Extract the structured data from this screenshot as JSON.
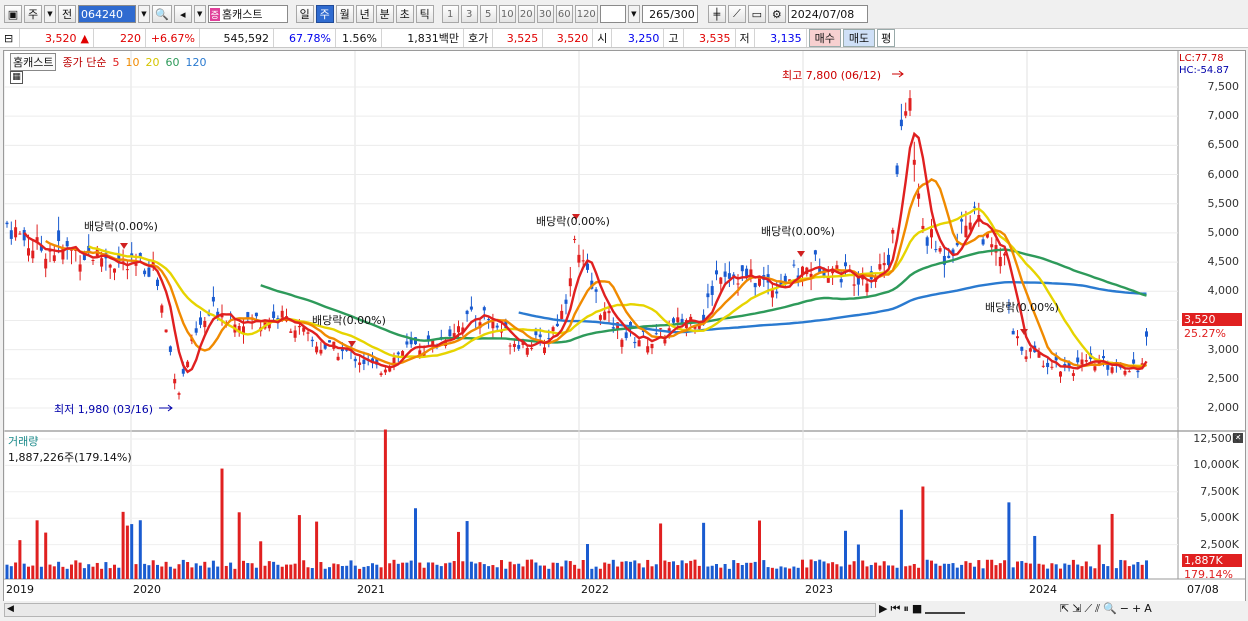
{
  "toolbar": {
    "period_type": "주",
    "prev_label": "전",
    "stock_code": "064240",
    "stock_name": "홈캐스트",
    "stock_badge": "증",
    "periods": [
      "일",
      "주",
      "월",
      "년",
      "분",
      "초",
      "틱"
    ],
    "active_period": "주",
    "intervals": [
      "1",
      "3",
      "5",
      "10",
      "20",
      "30",
      "60",
      "120"
    ],
    "count": "265",
    "count_total": "/300",
    "date": "2024/07/08"
  },
  "quote": {
    "price": "3,520",
    "change_arrow": "▲",
    "change": "220",
    "change_pct": "+6.67%",
    "volume": "545,592",
    "vol_ratio": "67.78%",
    "turnover": "1.56%",
    "amount": "1,831백만",
    "bid_label": "호가",
    "ask": "3,525",
    "bid": "3,520",
    "open_label": "시",
    "open": "3,250",
    "high_label": "고",
    "high": "3,535",
    "low_label": "저",
    "low": "3,135",
    "buy_button": "매수",
    "sell_button": "매도",
    "eval_button": "평"
  },
  "legend": {
    "name": "홈캐스트",
    "ma_label": "종가 단순",
    "ma": [
      {
        "period": "5",
        "color": "#e02020"
      },
      {
        "period": "10",
        "color": "#f08a00"
      },
      {
        "period": "20",
        "color": "#e6d400"
      },
      {
        "period": "60",
        "color": "#2e9a5a"
      },
      {
        "period": "120",
        "color": "#2a7ad0"
      }
    ]
  },
  "indicators": {
    "lc": "LC:77.78",
    "hc": "HC:-54.87"
  },
  "annotations": {
    "high": "최고 7,800 (06/12)",
    "low": "최저 1,980 (03/16)",
    "dividend": [
      "배당락(0.00%)",
      "배당락(0.00%)",
      "배당락(0.00%)",
      "배당락(0.00%)",
      "배당락(0.00%)"
    ]
  },
  "price_axis": [
    "7,500",
    "7,000",
    "6,500",
    "6,000",
    "5,500",
    "5,000",
    "4,500",
    "4,000",
    "3,500",
    "3,000",
    "2,500",
    "2,000"
  ],
  "current_price_tag": "3,520",
  "current_pct_tag": "25.27%",
  "volume_panel": {
    "title": "거래량",
    "value": "1,887,226주(179.14%)",
    "axis": [
      "12,500K",
      "10,000K",
      "7,500K",
      "5,000K",
      "2,500K"
    ],
    "current_tag": "1,887K",
    "current_pct": "179.14%"
  },
  "x_axis": [
    "2019",
    "2020",
    "2021",
    "2022",
    "2023",
    "2024"
  ],
  "last_date": "07/08",
  "colors": {
    "up": "#e02020",
    "down": "#1a5bd0",
    "accent": "#2f6bd0"
  }
}
